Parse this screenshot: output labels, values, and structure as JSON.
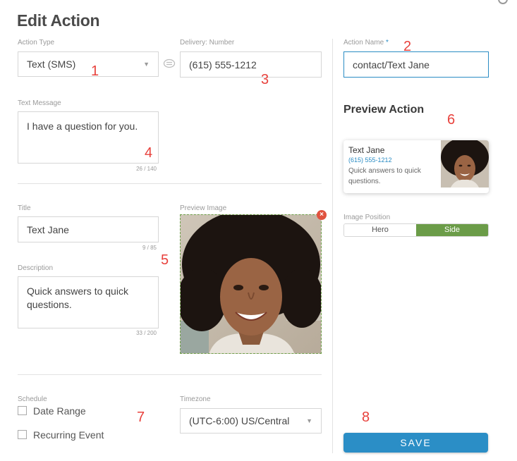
{
  "page": {
    "title": "Edit Action"
  },
  "action_type": {
    "label": "Action Type",
    "value": "Text (SMS)"
  },
  "delivery": {
    "label": "Delivery: Number",
    "value": "(615) 555-1212"
  },
  "text_message": {
    "label": "Text Message",
    "value": "I have a question for you.",
    "counter": "26 / 140"
  },
  "title_field": {
    "label": "Title",
    "value": "Text Jane",
    "counter": "9 / 85"
  },
  "description": {
    "label": "Description",
    "value": "Quick answers to quick questions.",
    "counter": "33 / 200"
  },
  "preview_image": {
    "label": "Preview Image",
    "remove_glyph": "×"
  },
  "schedule": {
    "label": "Schedule",
    "options": [
      "Date Range",
      "Recurring Event"
    ]
  },
  "timezone": {
    "label": "Timezone",
    "value": "(UTC-6:00) US/Central"
  },
  "action_name": {
    "label": "Action Name",
    "required_mark": "*",
    "value": "contact/Text Jane"
  },
  "preview_action": {
    "heading": "Preview Action",
    "card_title": "Text Jane",
    "card_phone": "(615) 555-1212",
    "card_desc": "Quick answers to quick questions."
  },
  "image_position": {
    "label": "Image Position",
    "options": [
      "Hero",
      "Side"
    ],
    "selected": "Side"
  },
  "save_label": "SAVE",
  "markers": [
    "1",
    "2",
    "3",
    "4",
    "5",
    "6",
    "7",
    "8"
  ],
  "colors": {
    "accent_blue": "#2b8ec6",
    "marker_red": "#e8413c",
    "selected_green": "#6b9c48",
    "remove_red": "#e0523f"
  },
  "icons": {
    "link": "link-icon",
    "caret": "caret-down-icon",
    "remove": "close-icon"
  }
}
